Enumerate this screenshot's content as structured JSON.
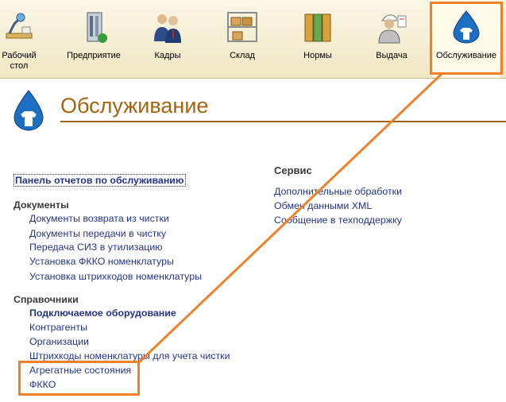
{
  "toolbar": {
    "items": [
      {
        "label": "Рабочий\nстол",
        "icon": "desk-lamp-icon"
      },
      {
        "label": "Предприятие",
        "icon": "building-icon"
      },
      {
        "label": "Кадры",
        "icon": "people-icon"
      },
      {
        "label": "Склад",
        "icon": "warehouse-boxes-icon"
      },
      {
        "label": "Нормы",
        "icon": "binders-icon"
      },
      {
        "label": "Выдача",
        "icon": "worker-icon"
      },
      {
        "label": "Обслуживание",
        "icon": "water-drop-shirt-icon"
      }
    ],
    "active_index": 6
  },
  "page": {
    "title": "Обслуживание",
    "panel_link": "Панель отчетов по обслуживанию"
  },
  "documents": {
    "heading": "Документы",
    "items": [
      "Документы возврата из чистки",
      "Документы передачи в чистку",
      "Передача СИЗ в утилизацию",
      "Установка ФККО номенклатуры",
      "Установка штрихкодов номенклатуры"
    ]
  },
  "catalogs": {
    "heading": "Справочники",
    "items": [
      "Подключаемое оборудование",
      "Контрагенты",
      "Организации",
      "Штрихкоды номенклатуры для учета чистки",
      "Агрегатные состояния",
      "ФККО"
    ]
  },
  "service": {
    "heading": "Сервис",
    "items": [
      "Дополнительные обработки",
      "Обмен данными XML",
      "Сообщение в техподдержку"
    ]
  },
  "colors": {
    "accent_orange": "#f0802a",
    "title_brown": "#a5640f",
    "link_blue": "#24348a",
    "toolbar_bg": "#efe6c3"
  }
}
